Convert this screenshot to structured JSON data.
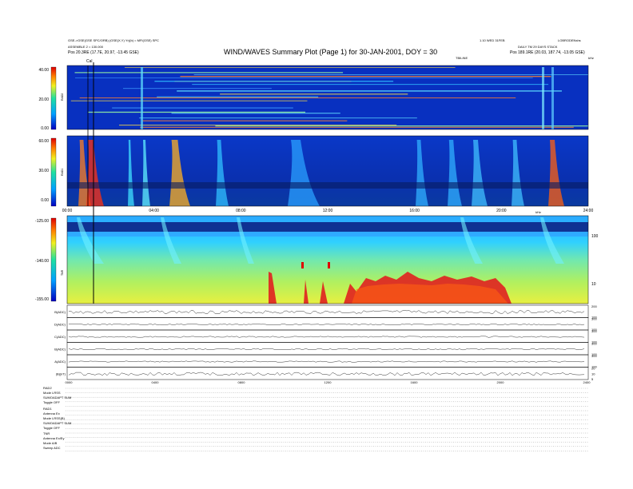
{
  "header": {
    "left_line1": "GSE->GSE(GSE SPC/ORB) (GSE(X,Y) Yr)(b) = MFI(GSE) SPC",
    "left_line2": "ASSEMBLE 2 = 130.000",
    "left_line3": "Pos 20.3RE (17.7E, 20.97, -13.45 GSE)",
    "center_title": "WIND/WAVES Summary Plot (Page 1) for 30-JAN-2001, DOY = 30",
    "right_top": "1.10 WED 31FEB",
    "right_top2": "LOBRODENshs",
    "right_line2": "DAILY TM 29 DAYS STACK",
    "right_line3": "Pos 189.1RE (20.03, 187.74, -13.05 GSE)",
    "right_small_label": "TBILINE",
    "right_unit": "kHz"
  },
  "chart_data": [
    {
      "type": "heatmap",
      "name": "RAD2",
      "ylabel": "RAD2",
      "yticks": [
        "40.00",
        "20.00",
        "0.00"
      ],
      "marker_label": "Cal"
    },
    {
      "type": "heatmap",
      "name": "RAD1",
      "ylabel": "RAD1",
      "yticks": [
        "60.00",
        "30.00",
        "0.00"
      ],
      "xticks": [
        "00:00",
        "04:00",
        "08:00",
        "12:00",
        "16:00",
        "20:00",
        "24:00"
      ]
    },
    {
      "type": "heatmap",
      "name": "TNR",
      "ylabel": "TNR",
      "yticks": [
        "-125.00",
        "-140.00",
        "-155.00"
      ],
      "right_ticks": [
        "100",
        "10"
      ],
      "right_label": "kHz"
    },
    {
      "type": "line",
      "panels": [
        {
          "label": "B(ADC)",
          "right_ticks": [
            "200",
            "100"
          ]
        },
        {
          "label": "D(ADC)",
          "right_ticks": [
            "300",
            "100"
          ]
        },
        {
          "label": "C(ADC)",
          "right_ticks": [
            "300",
            "100"
          ]
        },
        {
          "label": "B(ADC)",
          "right_ticks": [
            "300",
            "100"
          ]
        },
        {
          "label": "A(ADC)",
          "right_ticks": [
            "300",
            "100"
          ]
        },
        {
          "label": "|B|(nT)",
          "right_ticks": [
            "20",
            "10",
            "5"
          ]
        }
      ],
      "xticks": [
        "0000",
        "0400",
        "0800",
        "1200",
        "1600",
        "2000",
        "2400"
      ]
    }
  ],
  "footer": {
    "rad2_title": "RAD2",
    "rad2_rows": [
      {
        "k": "Mode",
        "v": "LRSS"
      },
      {
        "k": "SUMOADAPT",
        "v": "SUM"
      },
      {
        "k": "Toggle",
        "v": "OFF"
      }
    ],
    "rad1_title": "RAD1",
    "rad1_rows": [
      {
        "k": "Antenna",
        "v": "Ex"
      },
      {
        "k": "Mode",
        "v": "LRSS(B)"
      },
      {
        "k": "SUMOADAPT",
        "v": "SUM"
      },
      {
        "k": "Toggle",
        "v": "OFF"
      }
    ],
    "tnr_title": "TNR",
    "tnr_rows": [
      {
        "k": "Antenna",
        "v": "Ex/Ey"
      },
      {
        "k": "Mode",
        "v": "A/B"
      },
      {
        "k": "Sweep",
        "v": "ADC"
      }
    ]
  }
}
